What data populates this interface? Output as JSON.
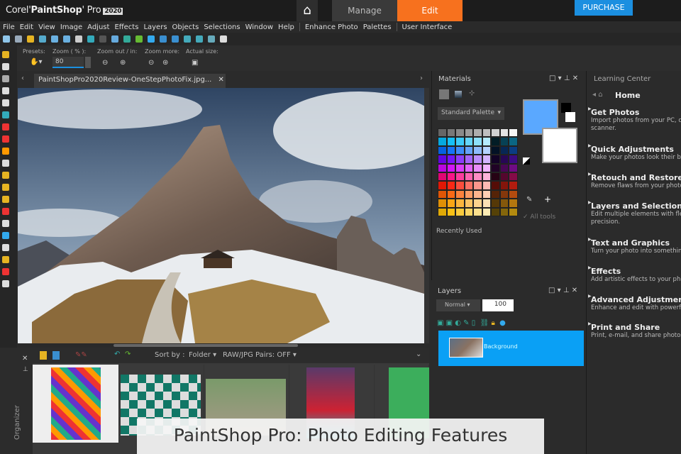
{
  "app": {
    "brand": "Corel",
    "name": "PaintShop",
    "pro": "Pro",
    "year": "2020"
  },
  "workspace_tabs": {
    "home_icon": "home-icon",
    "manage": "Manage",
    "edit": "Edit",
    "purchase": "PURCHASE",
    "accent": "#f7711e"
  },
  "menu": [
    "File",
    "Edit",
    "View",
    "Image",
    "Adjust",
    "Effects",
    "Layers",
    "Objects",
    "Selections",
    "Window",
    "Help",
    "Enhance Photo",
    "Palettes",
    "User Interface"
  ],
  "options": {
    "presets": "Presets:",
    "zoom_label": "Zoom ( % ):",
    "zoom_value": "80",
    "zoom_out_in": "Zoom out / in:",
    "zoom_more": "Zoom more:",
    "actual_size": "Actual size:"
  },
  "document": {
    "tab_title": "PaintShopPro2020Review-OneStepPhotoFix.jpg...",
    "close": "✕"
  },
  "organizer": {
    "label": "Organizer",
    "sort_by": "Sort by :",
    "sort_value": "Folder ▾",
    "raw_pairs": "RAW/JPG Pairs: OFF ▾"
  },
  "materials": {
    "title": "Materials",
    "palette_select": "Standard Palette",
    "all_tools": "All tools",
    "recently_used": "Recently Used",
    "foreground": "#5aa8ff",
    "background": "#ffffff"
  },
  "layers": {
    "title": "Layers",
    "blend_mode": "Normal",
    "opacity": "100",
    "layer_name": "Background",
    "selected_color": "#0aa0f5"
  },
  "learning_center": {
    "title": "Learning Center",
    "home": "Home",
    "items": [
      {
        "title": "Get Photos",
        "desc": "Import photos from your PC, camera or",
        "desc2": "scanner."
      },
      {
        "title": "Quick Adjustments",
        "desc": "Make your photos look their best"
      },
      {
        "title": "Retouch and Restore",
        "desc": "Remove flaws from your photos"
      },
      {
        "title": "Layers and Selections",
        "desc": "Edit multiple elements with flexibility and",
        "desc2": "precision."
      },
      {
        "title": "Text and Graphics",
        "desc": "Turn your photo into something"
      },
      {
        "title": "Effects",
        "desc": "Add artistic effects to your photos"
      },
      {
        "title": "Advanced Adjustments",
        "desc": "Enhance and edit with powerful"
      },
      {
        "title": "Print and Share",
        "desc": "Print, e-mail, and share photos."
      }
    ]
  },
  "caption": "PaintShop Pro: Photo Editing Features"
}
